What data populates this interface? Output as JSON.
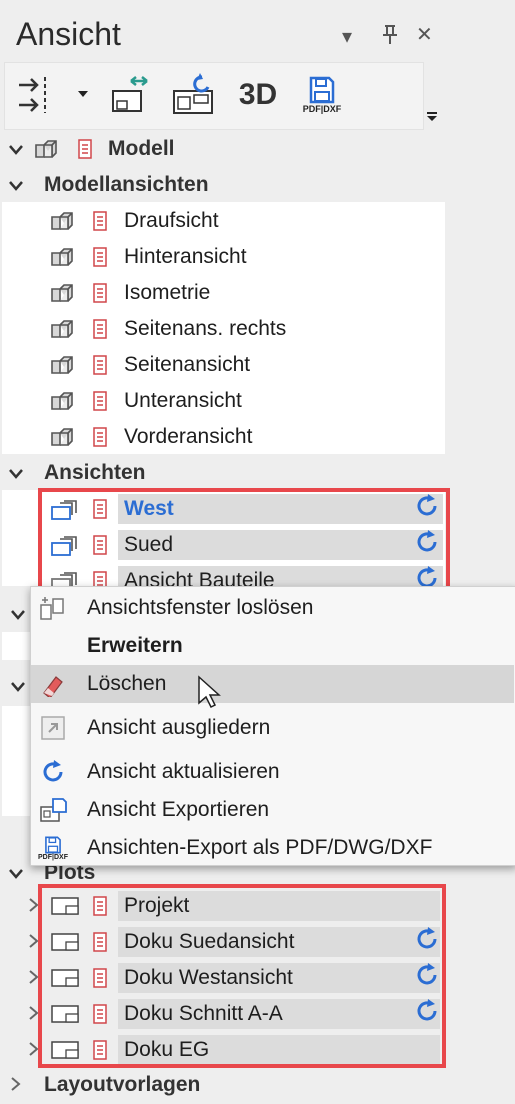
{
  "panel": {
    "title": "Ansicht",
    "buttons": {
      "dropdown": "▾",
      "pin": "⊥",
      "close": "✕"
    }
  },
  "toolbar": {
    "label_3d": "3D",
    "label_pdf": "PDF|DXF"
  },
  "tree": {
    "modell": {
      "label": "Modell"
    },
    "modellansichten": {
      "label": "Modellansichten",
      "items": [
        "Draufsicht",
        "Hinteransicht",
        "Isometrie",
        "Seitenans. rechts",
        "Seitenansicht",
        "Unteransicht",
        "Vorderansicht"
      ]
    },
    "ansichten": {
      "label": "Ansichten",
      "items": [
        "West",
        "Sued",
        "Ansicht Bauteile"
      ]
    },
    "plots": {
      "label": "Plots",
      "items": [
        "Projekt",
        "Doku Suedansicht",
        "Doku Westansicht",
        "Doku Schnitt A-A",
        "Doku EG"
      ]
    },
    "layoutvorlagen": {
      "label": "Layoutvorlagen"
    }
  },
  "context_menu": {
    "items": [
      {
        "label": "Ansichtsfenster loslösen",
        "icon": "detach-window-icon"
      },
      {
        "label": "Erweitern",
        "icon": ""
      },
      {
        "label": "Löschen",
        "icon": "eraser-icon"
      },
      {
        "label": "Ansicht ausgliedern",
        "icon": "export-arrow-icon"
      },
      {
        "label": "Ansicht aktualisieren",
        "icon": "refresh-icon"
      },
      {
        "label": "Ansicht Exportieren",
        "icon": "export-view-icon"
      },
      {
        "label": "Ansichten-Export als PDF/DWG/DXF",
        "icon": "pdf-dxf-icon"
      }
    ],
    "pdf_label": "PDF|DXF"
  },
  "colors": {
    "accent": "#2b6dd3",
    "highlight": "#e8474b",
    "doc_red": "#d0464a"
  }
}
